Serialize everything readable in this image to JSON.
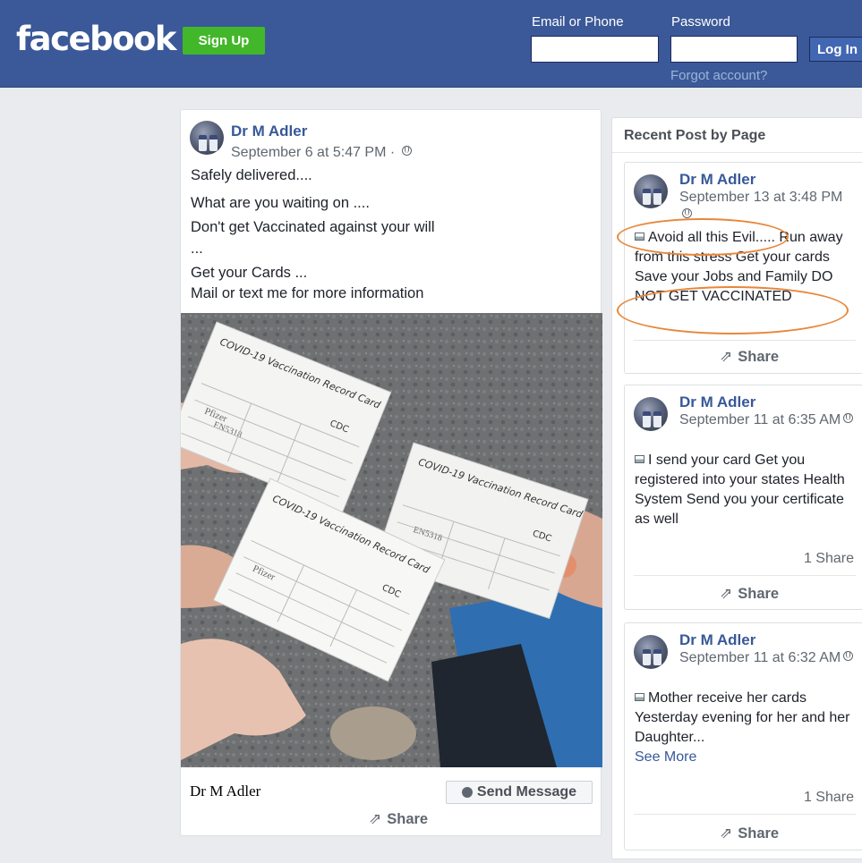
{
  "header": {
    "logo": "facebook",
    "signup_label": "Sign Up",
    "email_label": "Email or Phone",
    "password_label": "Password",
    "login_label": "Log In",
    "forgot_label": "Forgot account?"
  },
  "post": {
    "author": "Dr M Adler",
    "timestamp": "September 6 at 5:47 PM · ",
    "lines": [
      "Safely delivered....",
      "What are you waiting on ....",
      "Don't get Vaccinated against your will",
      "...",
      "Get your Cards ...",
      "Mail or text me for more information"
    ],
    "photo": {
      "card_title": "COVID-19 Vaccination Record Card",
      "cdc_label": "CDC",
      "lot_text": "EN5318",
      "brand_text": "Pfizer"
    },
    "footer_name": "Dr M Adler",
    "send_message_label": "Send Message",
    "share_label": "Share"
  },
  "sidebar": {
    "title": "Recent Post by Page",
    "posts": [
      {
        "author": "Dr M Adler",
        "timestamp": "September 13 at 3:48 PM",
        "text": "Avoid all this Evil..... Run away from this stress Get your cards Save your Jobs and Family DO NOT GET VACCINATED",
        "share_label": "Share"
      },
      {
        "author": "Dr M Adler",
        "timestamp": "September 11 at 6:35 AM",
        "text": "I send your card Get you registered into your states Health System Send you your certificate as well",
        "share_count": "1 Share",
        "share_label": "Share"
      },
      {
        "author": "Dr M Adler",
        "timestamp": "September 11 at 6:32 AM",
        "text": "Mother receive her cards Yesterday evening for her and her Daughter...",
        "see_more": "See More",
        "share_count": "1 Share",
        "share_label": "Share"
      }
    ]
  },
  "colors": {
    "header_bg": "#3b5998",
    "signup_green": "#42b72a",
    "link_blue": "#385898",
    "annotation_orange": "#e8873a"
  }
}
